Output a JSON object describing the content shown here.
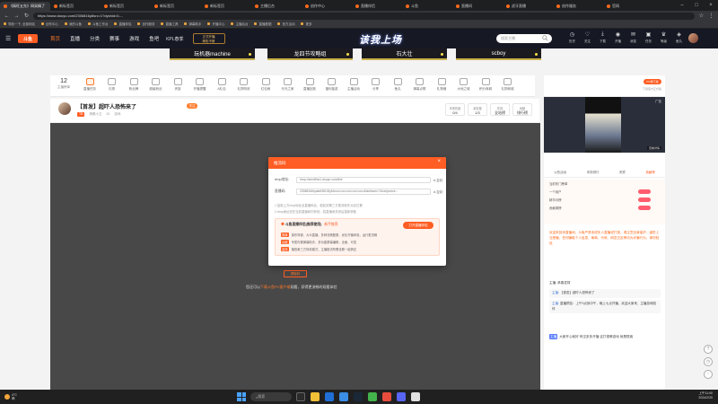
{
  "browser": {
    "tabs": [
      {
        "label": "《搞旺五先》网采精了",
        "active": true
      },
      {
        "label": "新标签页",
        "active": false
      },
      {
        "label": "新标签页",
        "active": false
      },
      {
        "label": "新标签页",
        "active": false
      },
      {
        "label": "新标签页",
        "active": false
      },
      {
        "label": "主播后台",
        "active": false
      },
      {
        "label": "创作中心",
        "active": false
      },
      {
        "label": "直播伴侣",
        "active": false
      },
      {
        "label": "斗鱼",
        "active": false
      },
      {
        "label": "直播间",
        "active": false
      },
      {
        "label": "虎牙直播",
        "active": false
      },
      {
        "label": "创作服务",
        "active": false
      },
      {
        "label": "官网",
        "active": false
      }
    ],
    "url": "https://www.douyu.com/2306816p8src=1?dyshid=0-...",
    "bookmarks": [
      "导航一下, 全部网站",
      "创作中心",
      "我的斗鱼",
      "斗鱼工作台",
      "直播伴侣",
      "创作服务",
      "直播工具",
      "弹幕助手",
      "开播中心",
      "主播后台",
      "直播数据",
      "官方活动",
      "更多"
    ]
  },
  "header": {
    "logo": "斗鱼",
    "nav": [
      {
        "label": "首页",
        "active": true
      },
      {
        "label": "直播",
        "active": false
      },
      {
        "label": "分类",
        "active": false
      },
      {
        "label": "赛事",
        "active": false
      },
      {
        "label": "游戏",
        "active": false
      },
      {
        "label": "鱼吧",
        "active": false
      }
    ],
    "kpl": "KPL春季",
    "promo_line1": "正式开播",
    "promo_line2": "精彩不断",
    "banner": "该我上场",
    "search_placeholder": "搜索主播",
    "icons": [
      {
        "name": "history-icon",
        "glyph": "◷",
        "label": "历史"
      },
      {
        "name": "follow-icon",
        "glyph": "♡",
        "label": "关注"
      },
      {
        "name": "download-icon",
        "glyph": "⤓",
        "label": "下载"
      },
      {
        "name": "broadcast-icon",
        "glyph": "◉",
        "label": "开播"
      },
      {
        "name": "message-icon",
        "glyph": "✉",
        "label": "消息"
      },
      {
        "name": "task-icon",
        "glyph": "▣",
        "label": "任务"
      },
      {
        "name": "level-icon",
        "glyph": "♛",
        "label": "等级"
      },
      {
        "name": "wallet-icon",
        "glyph": "◈",
        "label": "鱼丸"
      }
    ]
  },
  "sponsors": [
    "玩机器machine",
    "龙四节攻略组",
    "石大壮",
    "scboy"
  ],
  "toolbar": {
    "first_num": "12",
    "first_label": "主播榜单",
    "items": [
      {
        "label": "直播任务",
        "hl": true
      },
      {
        "label": "礼物",
        "hl": false
      },
      {
        "label": "粉丝牌",
        "hl": false
      },
      {
        "label": "超级粉丝",
        "hl": false
      },
      {
        "label": "贵族",
        "hl": false
      },
      {
        "label": "开播提醒",
        "hl": false
      },
      {
        "label": "A礼包",
        "hl": false
      },
      {
        "label": "礼物特效",
        "hl": false
      },
      {
        "label": "红包雨",
        "hl": false
      },
      {
        "label": "乐光之家",
        "hl": false
      },
      {
        "label": "直播回放",
        "hl": false
      },
      {
        "label": "福利抽奖",
        "hl": false
      },
      {
        "label": "主播活动",
        "hl": false
      },
      {
        "label": "分享",
        "hl": false
      },
      {
        "label": "鱼丸",
        "hl": false
      },
      {
        "label": "弹幕点歌",
        "hl": false
      },
      {
        "label": "礼物墙",
        "hl": false
      },
      {
        "label": "大地之城",
        "hl": false
      },
      {
        "label": "积分商城",
        "hl": false
      },
      {
        "label": "礼物商城",
        "hl": false
      }
    ]
  },
  "streamer": {
    "title": "【首发】超吓人恐怖来了",
    "badge": "关注",
    "tag": "TB",
    "name": "搞蛋小卫",
    "meta1": "20",
    "meta2": "游戏",
    "stats": [
      {
        "label": "本场热度",
        "value": "0/4"
      },
      {
        "label": "亲密度",
        "value": "1/3"
      },
      {
        "label": "在线",
        "value": "全站榜"
      },
      {
        "label": "贡献",
        "value": "排行榜"
      }
    ]
  },
  "player": {
    "under_button": "提取码",
    "hint_prefix": "您还可以",
    "hint_link": "下载斗鱼PC客户端",
    "hint_suffix": "观看，获得更流畅的观看体验"
  },
  "modal": {
    "title": "推流码",
    "rtmp_label": "rtmp地址:",
    "rtmp_value": "rtmp://sendfhw1.douyu.com/live",
    "key_label": "直播码:",
    "key_value": "2306816rbyakeNDUDyMo•••••••••••••••••••••••••••&isniswm=Y&onlyvoice...",
    "copy": "复制",
    "note1": "1.复制上方rtmp地址及直播码后，粘贴到第三方推流软件对应位置",
    "note2": "2.rtmp地址仅在当前直播间内有效，若直播间关闭后重新获取",
    "promo_title": "斗鱼直播伴侣(推荐使用)",
    "promo_sub": "新手推荐",
    "promo_button": "打开直播伴侣",
    "promo_lines": [
      {
        "tag": "简单",
        "text": "操作简便，大众直播，多种流畅配置，优化开播体验，运行更流畅"
      },
      {
        "tag": "功能",
        "text": "专属内置弹幕助手，多功能屏幕编辑，全面、可靠"
      },
      {
        "tag": "高效",
        "text": "播放第三方特效模式，主播推流所需设置一键搞定"
      }
    ]
  },
  "sidebar": {
    "top_button": "PC端下载",
    "top_sub": "下载官方正式版",
    "ad": "广告",
    "detail": "查看详情",
    "tabs": [
      {
        "label": "火热活动",
        "active": false
      },
      {
        "label": "本场排行",
        "active": false
      },
      {
        "label": "贵宾",
        "active": false
      },
      {
        "label": "贡献榜",
        "active": true
      }
    ],
    "ranks": [
      "当前热门榜单",
      "一个用户",
      "精华月榜",
      "贡献周榜"
    ],
    "messages": [
      {
        "text": "欢迎来到本直播间，斗鱼严禁未成年人直播或打赏，请注意自我保护，谨防上当受骗，任何骗取个人信息、刷单、代练、网恋交友等均为诈骗行为，请勿轻信",
        "dark": false
      },
      {
        "text": "主播: 恭喜发财",
        "dark": true
      }
    ],
    "box1_who": "主播:",
    "box1": "【首发】超吓人恐怖来了",
    "box2_who": "主播:",
    "box2": "直播预告：上午9点到中午，晚上七点开播，欢迎大家来，主播游戏陪伴",
    "footer_tag": "主播",
    "footer_text": "大家开心就好 有空多多开播 这打怪教游戏 就是很爽"
  },
  "taskbar": {
    "weather": "4°C",
    "weather_sub": "晴",
    "search": "搜索",
    "time": "上午11:00",
    "date": "2024/2/20"
  }
}
